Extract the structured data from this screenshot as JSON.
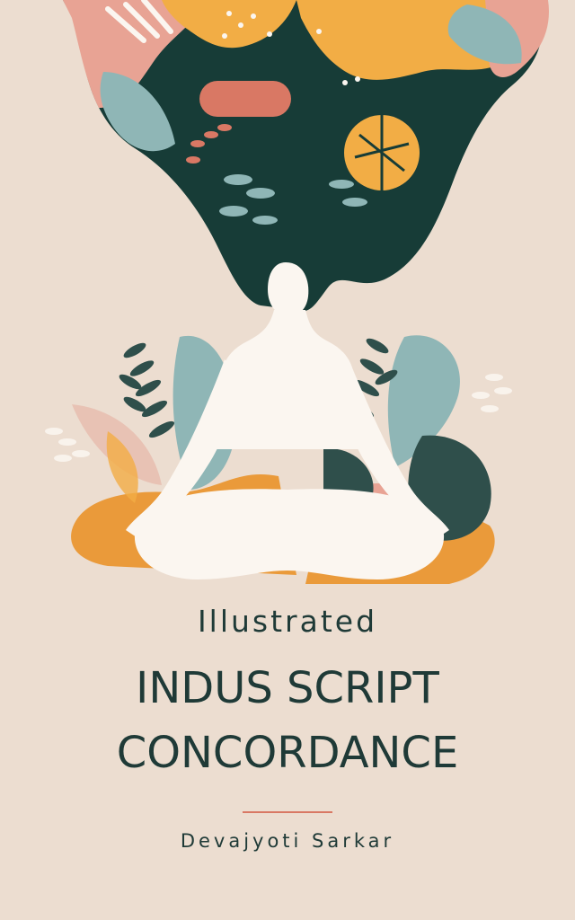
{
  "book": {
    "subtitle": "Illustrated",
    "title_line1": "INDUS SCRIPT",
    "title_line2": "CONCORDANCE",
    "author": "Devajyoti Sarkar"
  },
  "colors": {
    "background": "#ecddd0",
    "text": "#1f3a37",
    "hair": "#173c37",
    "figure": "#fbf6f0",
    "orange": "#ea9a3a",
    "mustard": "#f2ad45",
    "coral": "#d97864",
    "pink": "#e8a394",
    "teal": "#8fb6b6",
    "dark_green": "#2f4f4b",
    "accent_rule": "#d97864"
  }
}
